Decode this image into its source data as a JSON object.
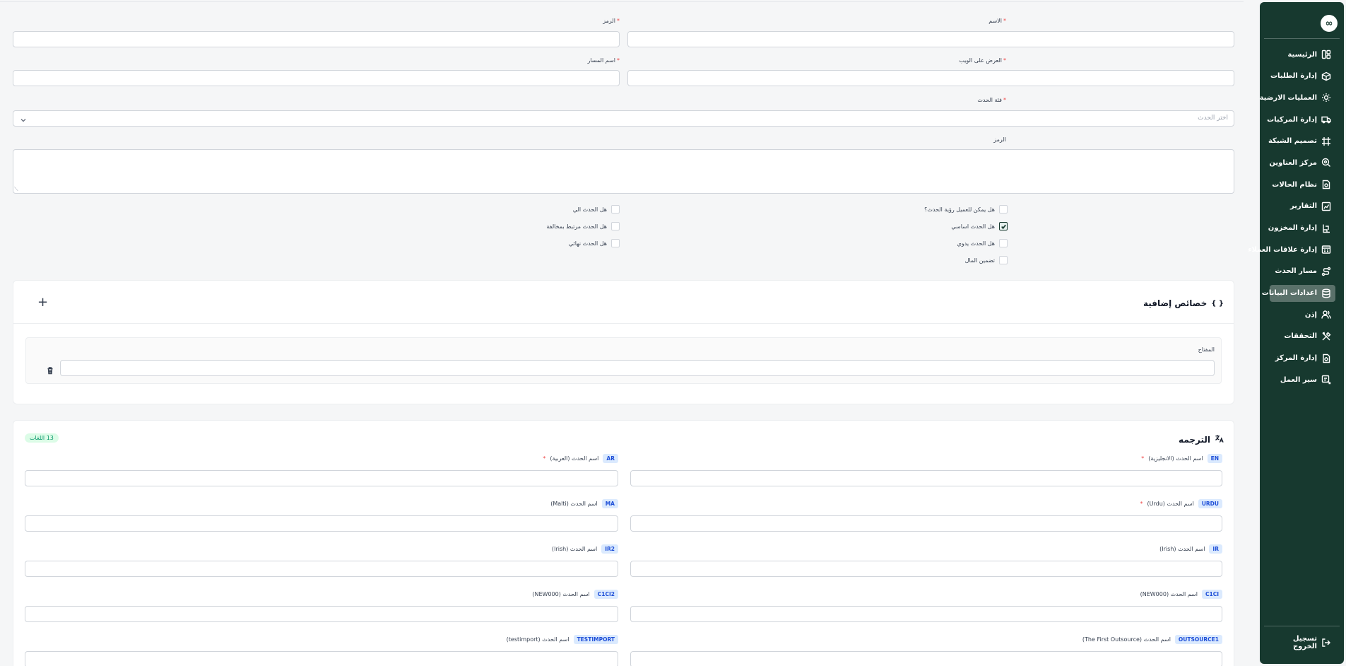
{
  "sidebar": {
    "logo_text": "∞",
    "items": [
      {
        "label": "الرئيسية",
        "icon": "layout-icon",
        "active": false
      },
      {
        "label": "إدارة الطلبات",
        "icon": "package-icon",
        "active": false
      },
      {
        "label": "العمليات الارضية",
        "icon": "sun-icon",
        "active": false
      },
      {
        "label": "إدارة المركبات",
        "icon": "truck-icon",
        "active": false
      },
      {
        "label": "تصميم الشبكة",
        "icon": "network-icon",
        "active": false
      },
      {
        "label": "مركز العناوين",
        "icon": "map-pin-icon",
        "active": false
      },
      {
        "label": "نظام الحالات",
        "icon": "file-status-icon",
        "active": false
      },
      {
        "label": "التقارير",
        "icon": "chart-icon",
        "active": false
      },
      {
        "label": "إدارة المخزون",
        "icon": "warehouse-icon",
        "active": false
      },
      {
        "label": "إدارة علاقات العملاء",
        "icon": "crm-icon",
        "active": false
      },
      {
        "label": "مسار الحدث",
        "icon": "route-icon",
        "active": false
      },
      {
        "label": "اعدادات البيانات",
        "icon": "database-icon",
        "active": true
      },
      {
        "label": "إذن",
        "icon": "users-icon",
        "active": false
      },
      {
        "label": "التحققات",
        "icon": "tools-icon",
        "active": false
      },
      {
        "label": "إدارة المركز",
        "icon": "center-icon",
        "active": false
      },
      {
        "label": "سير العمل",
        "icon": "workflow-icon",
        "active": false
      }
    ],
    "logout_label": "تسجيل الخروج"
  },
  "form": {
    "name_label": "الاسم",
    "code_label": "الرمز",
    "web_display_label": "العرض على الويب",
    "path_name_label": "اسم المسار",
    "event_category_label": "فئة الحدث",
    "event_category_placeholder": "اختر الحدث",
    "code_area_label": "الرمز",
    "required_mark": "*"
  },
  "checkboxes": [
    {
      "label": "هل يمكن للعميل رؤية الحدث؟",
      "checked": false
    },
    {
      "label": "هل الحدث اساسي",
      "checked": true
    },
    {
      "label": "هل الحدث يدوي",
      "checked": false
    },
    {
      "label": "تضمين المال",
      "checked": false
    },
    {
      "label": "هل الحدث الي",
      "checked": false
    },
    {
      "label": "هل الحدث مرتبط بمخالفة",
      "checked": false
    },
    {
      "label": "هل الحدث نهائي",
      "checked": false
    }
  ],
  "extra_props": {
    "braces": "{ }",
    "title": "خصائص إضافية",
    "add_symbol": "+",
    "key_label": "المفتاح"
  },
  "translation": {
    "title": "الترجمه",
    "languages_badge": "13 اللغات",
    "fields": [
      {
        "code": "EN",
        "label": "اسم الحدث (الانجليزية)",
        "required": true
      },
      {
        "code": "AR",
        "label": "اسم الحدث (العربية)",
        "required": true
      },
      {
        "code": "URDU",
        "label": "اسم الحدث (Urdu)",
        "required": true
      },
      {
        "code": "MA",
        "label": "اسم الحدث (Malti)",
        "required": false
      },
      {
        "code": "IR",
        "label": "اسم الحدث (Irish)",
        "required": false
      },
      {
        "code": "IR2",
        "label": "اسم الحدث (Irish)",
        "required": false
      },
      {
        "code": "C1CI",
        "label": "اسم الحدث (NEW000)",
        "required": false
      },
      {
        "code": "C1CI2",
        "label": "اسم الحدث (NEW000)",
        "required": false
      },
      {
        "code": "OUTSOURCE1",
        "label": "اسم الحدث (The First Outsource)",
        "required": false
      },
      {
        "code": "TESTIMPORT",
        "label": "اسم الحدث (testimport)",
        "required": false
      }
    ]
  },
  "colors": {
    "sidebar_bg": "#17392f",
    "active_item_bg": "#5a716a",
    "badge_green": "#059669",
    "code_blue": "#1d4ed8",
    "required_red": "#ef4444"
  }
}
